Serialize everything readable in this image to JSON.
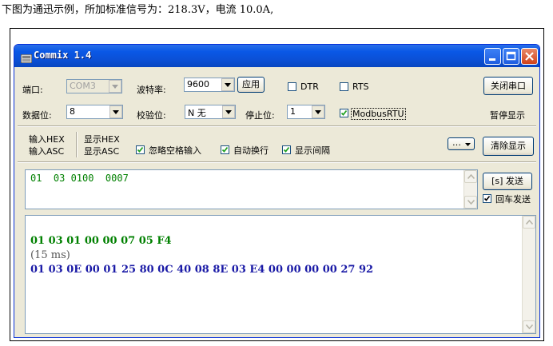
{
  "caption": "下图为通迅示例，所加标准信号为：218.3V，电流 10.0A,",
  "window": {
    "title": "Commix 1.4"
  },
  "serial": {
    "port_label": "端口:",
    "port_value": "COM3",
    "baud_label": "波特率:",
    "baud_value": "9600",
    "apply_label": "应用",
    "dtr_label": "DTR",
    "dtr_checked": false,
    "rts_label": "RTS",
    "rts_checked": false,
    "close_port_label": "关闭串口",
    "databits_label": "数据位:",
    "databits_value": "8",
    "parity_label": "校验位:",
    "parity_value": "N 无",
    "stopbits_label": "停止位:",
    "stopbits_value": "1",
    "modbus_label": "ModbusRTU",
    "modbus_checked": true,
    "pause_label": "暂停显示"
  },
  "mode": {
    "input_hex": "输入HEX",
    "input_asc": "输入ASC",
    "display_hex": "显示HEX",
    "display_asc": "显示ASC",
    "ignore_spaces_label": "忽略空格输入",
    "ignore_spaces_checked": true,
    "auto_wrap_label": "自动换行",
    "auto_wrap_checked": true,
    "show_interval_label": "显示间隔",
    "show_interval_checked": true,
    "more_label": "…",
    "clear_display_label": "清除显示"
  },
  "send": {
    "input_value": "01  03 0100  0007",
    "send_button_label": "[s] 发送",
    "enter_send_label": "回车发送",
    "enter_send_checked": true
  },
  "receive": {
    "tx_line": "01 03 01 00 00 07 05 F4",
    "interval_line": "(15 ms)",
    "rx_line": "01 03 0E 00 01 25 80 0C 40 08 8E 03 E4 00 00 00 00 27 92"
  },
  "colors": {
    "tx": "#008000",
    "interval": "#555555",
    "rx": "#1a1aa6",
    "title_blue": "#0a58e6"
  }
}
